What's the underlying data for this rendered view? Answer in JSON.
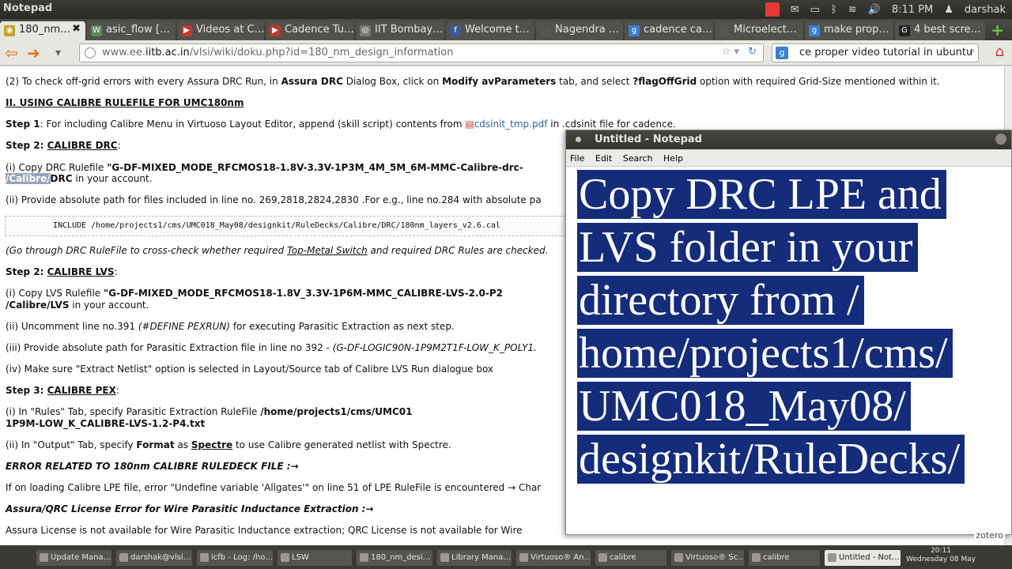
{
  "topbar": {
    "app": "Notepad",
    "time": "8:11 PM",
    "user": "darshak"
  },
  "tabs": [
    "180_nm…",
    "asic_flow […",
    "Videos at C…",
    "Cadence Tu…",
    "IIT Bombay…",
    "Welcome t…",
    "Nagendra …",
    "cadence ca…",
    "Microelect…",
    "make prop…",
    "4 best scre…"
  ],
  "url": {
    "prefix": "www.ee.",
    "host": "iitb.ac.in",
    "path": "/vlsi/wiki/doku.php?id=180_nm_design_information"
  },
  "search": {
    "value": "ce proper video tutorial in ubuntu"
  },
  "page": {
    "l1a": "(2) To check off-grid errors with every Assura DRC Run, in ",
    "l1b": "Assura DRC",
    "l1c": " Dialog Box, click on ",
    "l1d": "Modify avParameters",
    "l1e": " tab, and select ",
    "l1f": "?flagOffGrid",
    "l1g": " option with required Grid-Size mentioned within it.",
    "h2": "II. USING CALIBRE RULEFILE FOR UMC180nm",
    "s1a": "Step 1",
    "s1b": ": For including Calibre Menu in Virtuoso Layout Editor, append (skill script) contents from ",
    "s1pdf": "cdsinit_tmp.pdf",
    "s1c": " in .cdsinit file for cadence.",
    "s2a": "Step 2: ",
    "s2b": "CALIBRE DRC",
    "s2c": ":",
    "d1a": "(i)   Copy   DRC   Rulefile  ",
    "d1b": "\"G-DF-MIXED_MODE_RFCMOS18-1.8V-3.3V-1P3M_4M_5M_6M-MMC-Calibre-drc-",
    "d2a": "/Calibre/",
    "d2b": "DRC",
    "d2c": " in your account.",
    "d3": "(ii) Provide absolute path for files included in line no. 269,2818,2824,2830 .For e.g., line no.284 with absolute pa",
    "code": "INCLUDE /home/projects1/cms/UMC018_May08/designkit/RuleDecks/Calibre/DRC/180nm_layers_v2.6.cal",
    "d4a": "(Go through DRC RuleFile to cross-check whether required ",
    "d4b": "Top-Metal Switch",
    "d4c": " and required DRC Rules are checked.",
    "s3a": "Step 2: ",
    "s3b": "CALIBRE LVS",
    "s3c": ":",
    "v1a": "(i)    Copy    LVS    Rulefile    ",
    "v1b": "\"G-DF-MIXED_MODE_RFCMOS18-1.8V_3.3V-1P6M-MMC_CALIBRE-LVS-2.0-P2",
    "v2a": "/Calibre/LVS",
    "v2b": " in your account.",
    "v3a": "(ii) Uncomment line no.391 ",
    "v3b": "(#DEFINE PEXRUN)",
    "v3c": " for executing Parasitic Extraction as next step.",
    "v4a": "(iii) Provide absolute path for Parasitic Extraction file in line no 392 - ",
    "v4b": "(G-DF-LOGIC90N-1P9M2T1F-LOW_K_POLY1.",
    "v5": "(iv) Make sure \"Extract Netlist\" option is selected in Layout/Source tab of Calibre LVS Run dialogue box",
    "s4a": "Step 3: ",
    "s4b": "CALIBRE PEX",
    "s4c": ":",
    "p1a": "(i)      In      \"Rules\"      Tab,      specify      Parasitic      Extraction      RuleFile      ",
    "p1b": "/home/projects1/cms/UMC01",
    "p2": "1P9M-LOW_K_CALIBRE-LVS-1.2-P4.txt",
    "p3a": "(ii) In \"Output\" Tab, specify ",
    "p3b": "Format",
    "p3c": " as ",
    "p3d": "Spectre",
    "p3e": " to use Calibre generated netlist with Spectre.",
    "e1": "ERROR RELATED TO 180nm CALIBRE RULEDECK FILE :→",
    "e2": "If on loading Calibre LPE file, error \"Undefine variable 'Allgates'\" on line 51 of LPE RuleFile is encountered → Char",
    "e3": "Assura/QRC License Error for Wire Parasitic Inductance Extraction :→",
    "e4": "Assura License is not available for Wire Parasitic Inductance extraction; QRC License is not available for Wire"
  },
  "notepad": {
    "title": "Untitled - Notepad",
    "menu": [
      "File",
      "Edit",
      "Search",
      "Help"
    ],
    "lines": [
      "Copy DRC LPE and",
      "LVS folder in your",
      "directory from /",
      "home/projects1/cms/",
      "UMC018_May08/",
      "designkit/RuleDecks/"
    ]
  },
  "zotero": "zotero",
  "taskbar": {
    "items": [
      "Update Mana…",
      "darshak@vlsi…",
      "icfb - Log: /ho…",
      "LSW",
      "180_nm_desi…",
      "Library Mana…",
      "Virtuoso® An…",
      "calibre",
      "Virtuoso® Sc…",
      "calibre",
      "Untitled - Not…"
    ],
    "clock": "20:11",
    "date": "Wednesday 08 May"
  }
}
